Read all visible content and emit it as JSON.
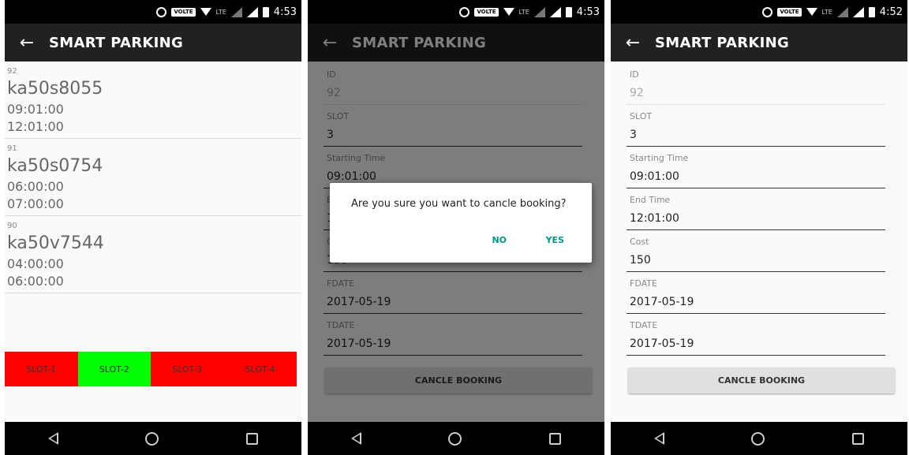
{
  "app": {
    "title": "SMART PARKING"
  },
  "status_times": [
    "4:53",
    "4:53",
    "4:52"
  ],
  "status": {
    "volte": "VOLTE",
    "lte": "LTE"
  },
  "bookings": [
    {
      "id": "92",
      "plate": "ka50s8055",
      "start": "09:01:00",
      "end": "12:01:00"
    },
    {
      "id": "91",
      "plate": "ka50s0754",
      "start": "06:00:00",
      "end": "07:00:00"
    },
    {
      "id": "90",
      "plate": "ka50v7544",
      "start": "04:00:00",
      "end": "06:00:00"
    }
  ],
  "slots": [
    {
      "label": "SLOT-1",
      "color": "#ff0000"
    },
    {
      "label": "SLOT-2",
      "color": "#00ff00"
    },
    {
      "label": "SLOT-3",
      "color": "#ff0000"
    },
    {
      "label": "SLOT-4",
      "color": "#ff0000"
    }
  ],
  "detail": {
    "id_label": "ID",
    "id_value": "92",
    "slot_label": "SLOT",
    "slot_value": "3",
    "start_label": "Starting Time",
    "start_value": "09:01:00",
    "end_label": "End Time",
    "end_value": "12:01:00",
    "cost_label": "Cost",
    "cost_value": "150",
    "fdate_label": "FDATE",
    "fdate_value": "2017-05-19",
    "tdate_label": "TDATE",
    "tdate_value": "2017-05-19",
    "cancel_button": "CANCLE BOOKING"
  },
  "dialog": {
    "message": "Are you sure you want to cancle booking?",
    "no": "NO",
    "yes": "YES"
  },
  "colors": {
    "appbar": "#212121",
    "accent": "#009688"
  }
}
